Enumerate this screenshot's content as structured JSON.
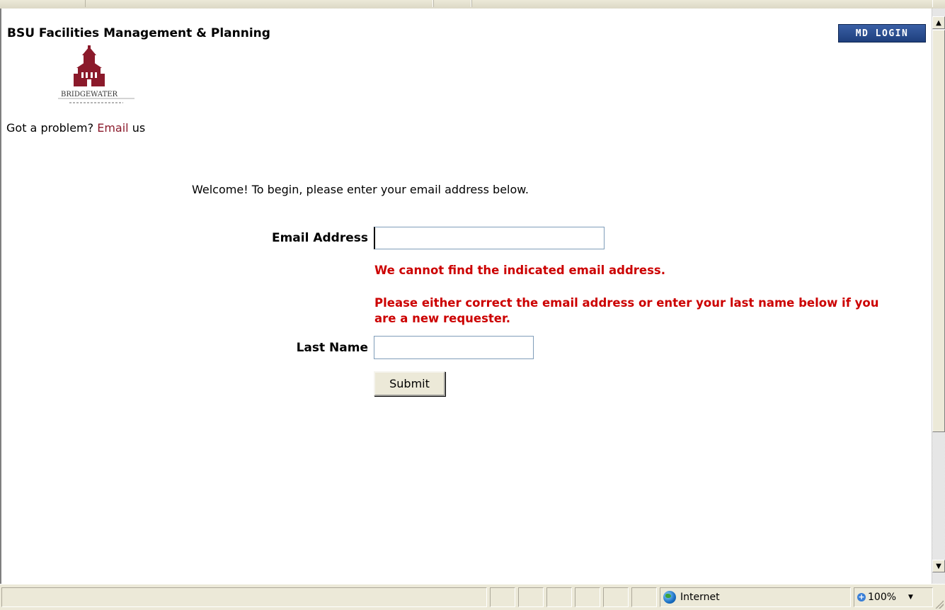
{
  "header": {
    "site_title": "BSU Facilities Management & Planning",
    "login_button": "MD LOGIN",
    "logo_text": "BRIDGEWATER"
  },
  "help": {
    "prefix": "Got a problem?",
    "email_link": "Email",
    "suffix": "us"
  },
  "form": {
    "welcome": "Welcome! To begin, please enter your email address below.",
    "email_label": "Email Address",
    "email_value": "",
    "error_not_found": "We cannot find the indicated email address.",
    "error_instructions": "Please either correct the email address or enter your last name below if you are a new requester.",
    "last_name_label": "Last Name",
    "last_name_value": "",
    "submit_label": "Submit"
  },
  "statusbar": {
    "zone": "Internet",
    "zoom": "100%"
  },
  "colors": {
    "error": "#cc0000",
    "link": "#8b1a2b",
    "login_bg": "#1e3f7d"
  }
}
